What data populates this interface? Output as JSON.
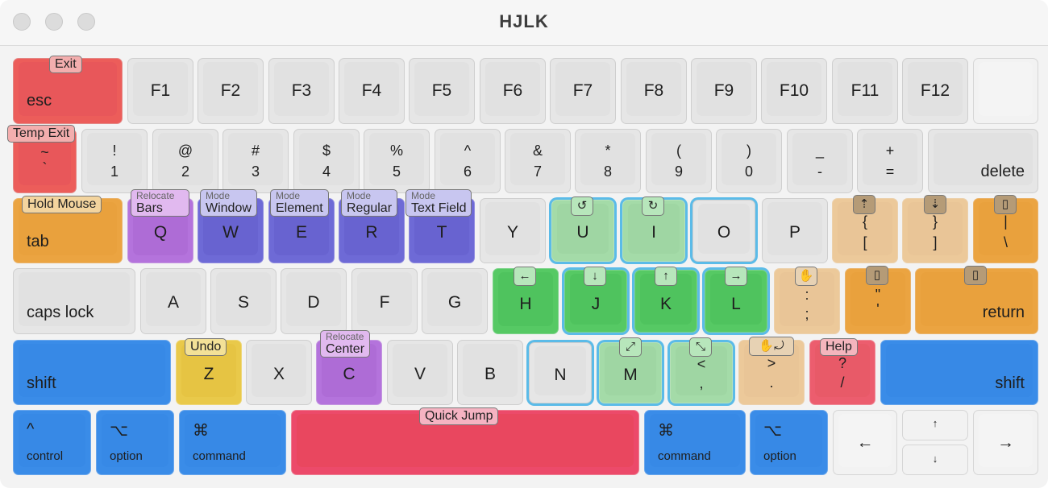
{
  "window": {
    "title": "HJLK"
  },
  "keys": {
    "esc": "esc",
    "f1": "F1",
    "f2": "F2",
    "f3": "F3",
    "f4": "F4",
    "f5": "F5",
    "f6": "F6",
    "f7": "F7",
    "f8": "F8",
    "f9": "F9",
    "f10": "F10",
    "f11": "F11",
    "f12": "F12",
    "tilde_top": "~",
    "tilde_bot": "`",
    "n1_top": "!",
    "n1_bot": "1",
    "n2_top": "@",
    "n2_bot": "2",
    "n3_top": "#",
    "n3_bot": "3",
    "n4_top": "$",
    "n4_bot": "4",
    "n5_top": "%",
    "n5_bot": "5",
    "n6_top": "^",
    "n6_bot": "6",
    "n7_top": "&",
    "n7_bot": "7",
    "n8_top": "*",
    "n8_bot": "8",
    "n9_top": "(",
    "n9_bot": "9",
    "n0_top": ")",
    "n0_bot": "0",
    "minus_top": "_",
    "minus_bot": "-",
    "eq_top": "+",
    "eq_bot": "=",
    "delete": "delete",
    "tab": "tab",
    "q": "Q",
    "w": "W",
    "e": "E",
    "r": "R",
    "t": "T",
    "y": "Y",
    "u": "U",
    "i": "I",
    "o": "O",
    "p": "P",
    "lbr_top": "{",
    "lbr_bot": "[",
    "rbr_top": "}",
    "rbr_bot": "]",
    "bsl_top": "|",
    "bsl_bot": "\\",
    "caps": "caps lock",
    "a": "A",
    "s": "S",
    "d": "D",
    "f": "F",
    "g": "G",
    "h": "H",
    "j": "J",
    "k": "K",
    "l": "L",
    "semi_top": ":",
    "semi_bot": ";",
    "quote_top": "\"",
    "quote_bot": "'",
    "return": "return",
    "shift_l": "shift",
    "z": "Z",
    "x": "X",
    "c": "C",
    "v": "V",
    "b": "B",
    "n": "N",
    "m": "M",
    "comma_top": "<",
    "comma_bot": ",",
    "period_top": ">",
    "period_bot": ".",
    "slash_top": "?",
    "slash_bot": "/",
    "shift_r": "shift",
    "control": "control",
    "control_sym": "^",
    "option_l": "option",
    "option_sym": "⌥",
    "command_l": "command",
    "command_sym": "⌘",
    "command_r": "command",
    "option_r": "option",
    "arrow_left": "←",
    "arrow_up": "↑",
    "arrow_down": "↓",
    "arrow_right": "→"
  },
  "badges": {
    "exit": "Exit",
    "temp_exit": "Temp Exit",
    "hold_mouse": "Hold Mouse",
    "relocate_bars_small": "Relocate",
    "relocate_bars_big": "Bars",
    "mode_window_small": "Mode",
    "mode_window_big": "Window",
    "mode_element_small": "Mode",
    "mode_element_big": "Element",
    "mode_regular_small": "Mode",
    "mode_regular_big": "Regular",
    "mode_textfield_small": "Mode",
    "mode_textfield_big": "Text Field",
    "undo": "Undo",
    "relocate_center_small": "Relocate",
    "relocate_center_big": "Center",
    "help": "Help",
    "quick_jump": "Quick Jump"
  },
  "icons": {
    "rotate_ccw": "↺",
    "rotate_cw": "↻",
    "arrow_left": "←",
    "arrow_down": "↓",
    "arrow_up": "↑",
    "arrow_right": "→",
    "expand": "⤢",
    "shrink": "⤡",
    "grab": "✋",
    "grab_drop": "✋⤾",
    "scroll_up": "⇡",
    "scroll_down": "⇣",
    "mouse": "▯"
  }
}
